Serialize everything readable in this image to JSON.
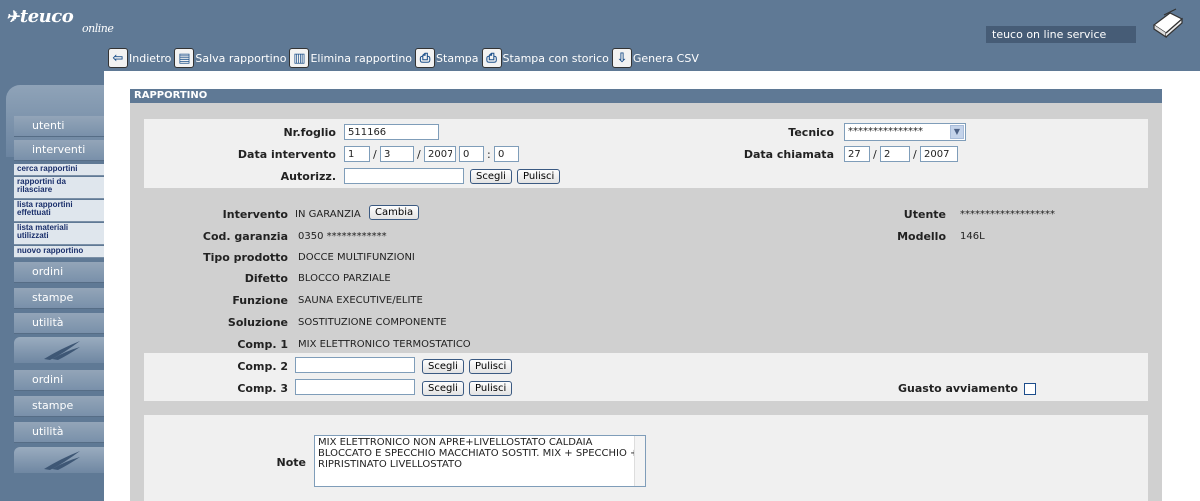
{
  "header": {
    "logo_text": "teuco",
    "logo_sub": "online",
    "service_label": "teuco on line service"
  },
  "toolbar": {
    "items": [
      {
        "label": "Indietro",
        "icon": "back-arrow-icon"
      },
      {
        "label": "Salva rapportino",
        "icon": "save-document-icon"
      },
      {
        "label": "Elimina rapportino",
        "icon": "trash-icon"
      },
      {
        "label": "Stampa",
        "icon": "printer-icon"
      },
      {
        "label": "Stampa con storico",
        "icon": "printer-history-icon"
      },
      {
        "label": "Genera CSV",
        "icon": "csv-download-icon"
      }
    ]
  },
  "sidebar": {
    "group1": [
      {
        "label": "utenti"
      },
      {
        "label": "interventi"
      }
    ],
    "subitems": [
      {
        "label": "cerca rapportini"
      },
      {
        "label": "rapportini da rilasciare"
      },
      {
        "label": "lista rapportini effettuati"
      },
      {
        "label": "lista materiali utilizzati"
      },
      {
        "label": "nuovo rapportino"
      }
    ],
    "group2": [
      {
        "label": "ordini"
      },
      {
        "label": "stampe"
      },
      {
        "label": "utilità"
      }
    ],
    "group3": [
      {
        "label": "ordini"
      },
      {
        "label": "stampe"
      },
      {
        "label": "utilità"
      }
    ]
  },
  "form": {
    "title": "RAPPORTINO",
    "nr_foglio_label": "Nr.foglio",
    "nr_foglio_value": "511166",
    "tecnico_label": "Tecnico",
    "tecnico_value": "***************",
    "data_intervento_label": "Data intervento",
    "data_intervento": {
      "day": "1",
      "month": "3",
      "year": "2007",
      "hour": "0",
      "minute": "0"
    },
    "data_chiamata_label": "Data chiamata",
    "data_chiamata": {
      "day": "27",
      "month": "2",
      "year": "2007"
    },
    "autorizz_label": "Autorizz.",
    "autorizz_value": "",
    "btn_scegli": "Scegli",
    "btn_pulisci": "Pulisci",
    "btn_cambia": "Cambia",
    "intervento_label": "Intervento",
    "intervento_value": "IN GARANZIA",
    "utente_label": "Utente",
    "utente_value": "*******************",
    "cod_garanzia_label": "Cod. garanzia",
    "cod_garanzia_value": "0350 ************",
    "modello_label": "Modello",
    "modello_value": "146L",
    "tipo_prodotto_label": "Tipo prodotto",
    "tipo_prodotto_value": "DOCCE MULTIFUNZIONI",
    "difetto_label": "Difetto",
    "difetto_value": "BLOCCO PARZIALE",
    "funzione_label": "Funzione",
    "funzione_value": "SAUNA EXECUTIVE/ELITE",
    "soluzione_label": "Soluzione",
    "soluzione_value": "SOSTITUZIONE COMPONENTE",
    "comp1_label": "Comp. 1",
    "comp1_value": "MIX ELETTRONICO TERMOSTATICO",
    "comp2_label": "Comp. 2",
    "comp2_value": "",
    "comp3_label": "Comp. 3",
    "comp3_value": "",
    "guasto_label": "Guasto avviamento",
    "note_label": "Note",
    "note_value": "MIX ELETTRONICO NON APRE+LIVELLOSTATO CALDAIA BLOCCATO E SPECCHIO MACCHIATO  SOSTIT. MIX + SPECCHIO + RIPRISTINATO LIVELLOSTATO"
  }
}
